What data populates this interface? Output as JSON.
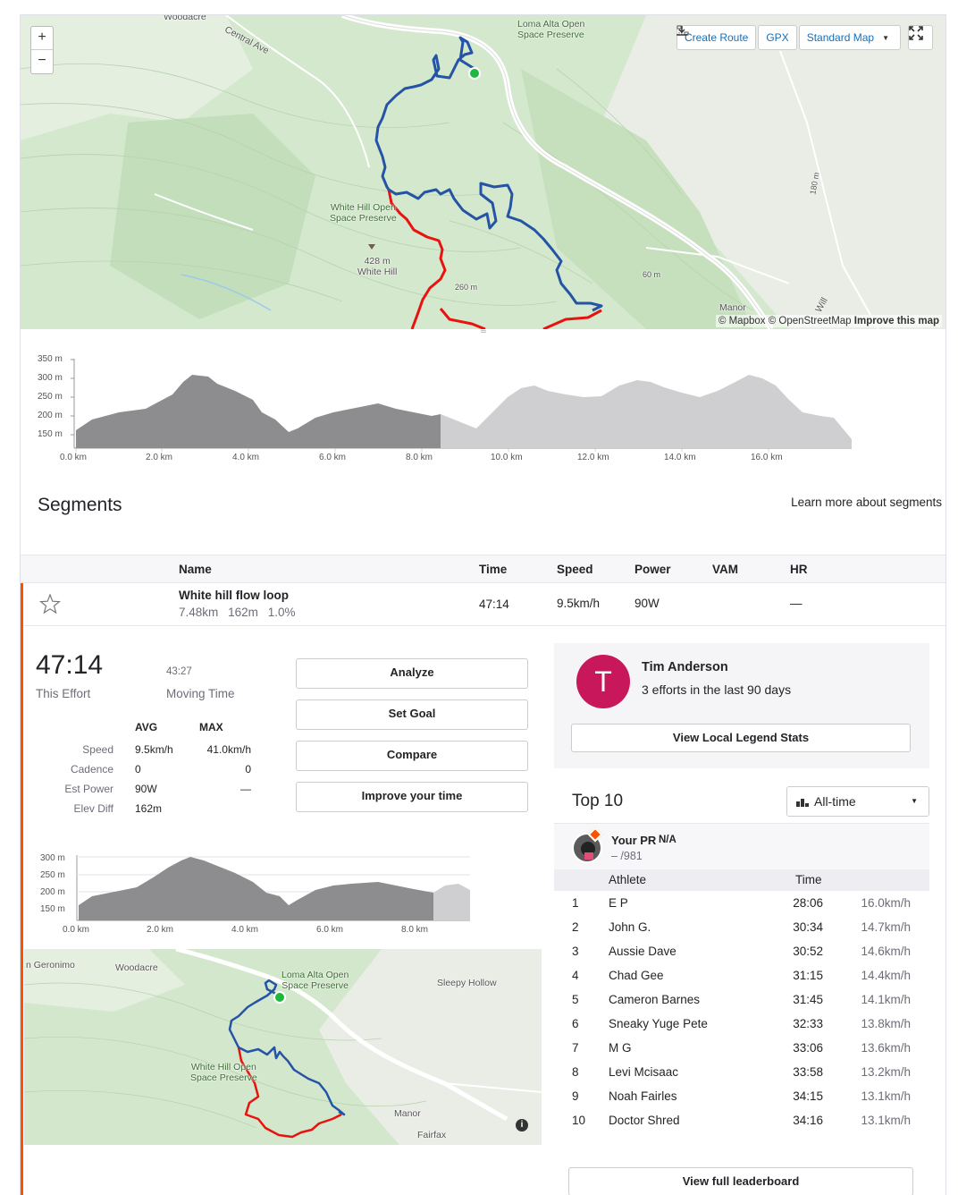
{
  "map": {
    "zoom_in": "+",
    "zoom_out": "−",
    "create_route": "Create Route",
    "gpx": "GPX",
    "map_type": "Standard Map",
    "attribution": "© Mapbox © OpenStreetMap",
    "improve": "Improve this map",
    "labels": {
      "woodacre": "Woodacre",
      "central_ave": "Central Ave",
      "loma_alta_1": "Loma Alta Open",
      "loma_alta_2": "Space Preserve",
      "white_hill_os_1": "White Hill Open",
      "white_hill_os_2": "Space Preserve",
      "peak_elev": "428 m",
      "peak_name": "White Hill",
      "contour_260": "260 m",
      "contour_60": "60 m",
      "contour_180": "180 m",
      "manor": "Manor",
      "will": "Will"
    },
    "colors": {
      "route_blue": "#2553a6",
      "route_red": "#e8130f",
      "start": "#1db83d"
    }
  },
  "elevation": {
    "y_ticks": [
      "350 m",
      "300 m",
      "250 m",
      "200 m",
      "150 m"
    ],
    "x_ticks": [
      "0.0 km",
      "2.0 km",
      "4.0 km",
      "6.0 km",
      "8.0 km",
      "10.0 km",
      "12.0 km",
      "14.0 km",
      "16.0 km"
    ]
  },
  "segments": {
    "title": "Segments",
    "learn_more": "Learn more about segments",
    "columns": {
      "name": "Name",
      "time": "Time",
      "speed": "Speed",
      "power": "Power",
      "vam": "VAM",
      "hr": "HR"
    },
    "row": {
      "name": "White hill flow loop",
      "distance": "7.48",
      "distance_unit": "km",
      "elev": "162",
      "elev_unit": "m",
      "grade": "1.0",
      "grade_unit": "%",
      "time": "47:14",
      "speed": "9.5",
      "speed_unit": "km/h",
      "power": "90",
      "power_unit": "W",
      "hr": "—"
    }
  },
  "effort": {
    "time": "47:14",
    "time_label": "This Effort",
    "moving_time": "43:27",
    "moving_label": "Moving Time",
    "avg_label": "AVG",
    "max_label": "MAX",
    "rows": [
      {
        "label": "Speed",
        "avg": "9.5",
        "avg_unit": "km/h",
        "max": "41.0",
        "max_unit": "km/h"
      },
      {
        "label": "Cadence",
        "avg": "0",
        "avg_unit": "",
        "max": "0",
        "max_unit": ""
      },
      {
        "label": "Est Power",
        "avg": "90",
        "avg_unit": "W",
        "max": "—",
        "max_unit": ""
      },
      {
        "label": "Elev Diff",
        "avg": "162",
        "avg_unit": "m",
        "max": "",
        "max_unit": ""
      }
    ],
    "buttons": {
      "analyze": "Analyze",
      "set_goal": "Set Goal",
      "compare": "Compare",
      "improve": "Improve your time"
    },
    "mini_elev": {
      "y_ticks": [
        "300 m",
        "250 m",
        "200 m",
        "150 m"
      ],
      "x_ticks": [
        "0.0 km",
        "2.0 km",
        "4.0 km",
        "6.0 km",
        "8.0 km"
      ]
    },
    "small_map": {
      "geronimo": "n Geronimo",
      "woodacre": "Woodacre",
      "loma_1": "Loma Alta Open",
      "loma_2": "Space Preserve",
      "sleepy": "Sleepy Hollow",
      "wh_1": "White Hill Open",
      "wh_2": "Space Preserve",
      "manor": "Manor",
      "fairfax": "Fairfax"
    }
  },
  "local_legend": {
    "initial": "T",
    "name": "Tim Anderson",
    "efforts": "3 efforts in the last 90 days",
    "button": "View Local Legend Stats"
  },
  "leaderboard": {
    "title": "Top 10",
    "filter": "All-time",
    "pr_label": "Your PR",
    "pr_value": "N/A",
    "pr_rank": "– /981",
    "col_athlete": "Athlete",
    "col_time": "Time",
    "rows": [
      {
        "rank": "1",
        "name": "E P",
        "time": "28:06",
        "speed": "16.0"
      },
      {
        "rank": "2",
        "name": "John G.",
        "time": "30:34",
        "speed": "14.7"
      },
      {
        "rank": "3",
        "name": "Aussie Dave",
        "time": "30:52",
        "speed": "14.6"
      },
      {
        "rank": "4",
        "name": "Chad Gee",
        "time": "31:15",
        "speed": "14.4"
      },
      {
        "rank": "5",
        "name": "Cameron Barnes",
        "time": "31:45",
        "speed": "14.1"
      },
      {
        "rank": "6",
        "name": "Sneaky Yuge Pete",
        "time": "32:33",
        "speed": "13.8"
      },
      {
        "rank": "7",
        "name": "M G",
        "time": "33:06",
        "speed": "13.6"
      },
      {
        "rank": "8",
        "name": "Levi Mcisaac",
        "time": "33:58",
        "speed": "13.2"
      },
      {
        "rank": "9",
        "name": "Noah Fairles",
        "time": "34:15",
        "speed": "13.1"
      },
      {
        "rank": "10",
        "name": "Doctor Shred",
        "time": "34:16",
        "speed": "13.1"
      }
    ],
    "speed_unit": "km/h",
    "view_full": "View full leaderboard"
  }
}
